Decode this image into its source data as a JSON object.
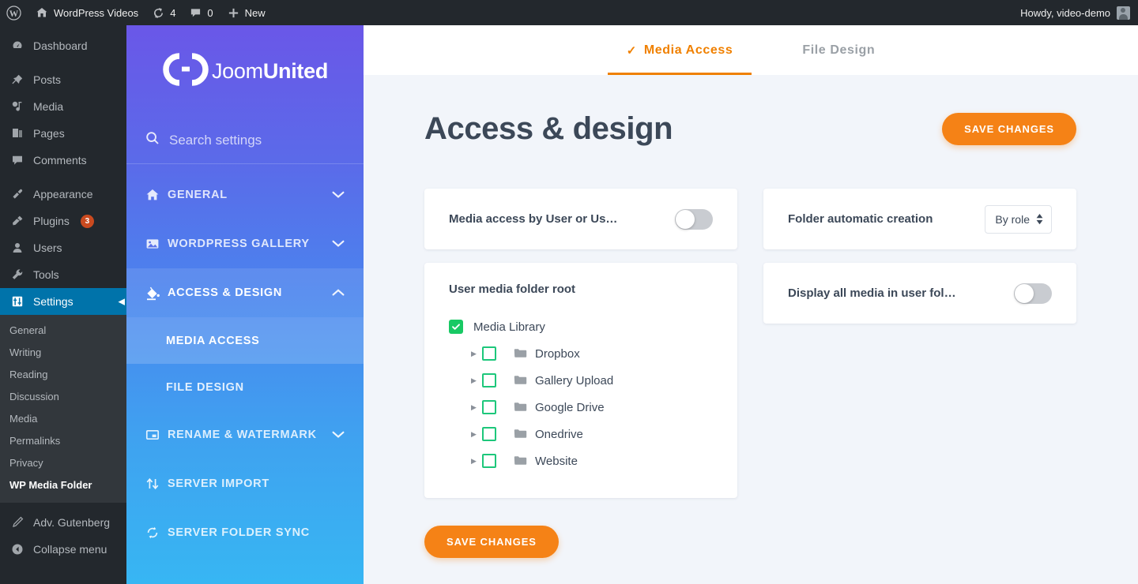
{
  "adminbar": {
    "site_name": "WordPress Videos",
    "updates_count": "4",
    "comments_count": "0",
    "new_label": "New",
    "howdy": "Howdy, video-demo"
  },
  "wpmenu": {
    "items": [
      {
        "label": "Dashboard",
        "icon": "dashboard-icon"
      },
      {
        "label": "Posts",
        "icon": "pin-icon"
      },
      {
        "label": "Media",
        "icon": "media-icon"
      },
      {
        "label": "Pages",
        "icon": "pages-icon"
      },
      {
        "label": "Comments",
        "icon": "comment-icon"
      },
      {
        "label": "Appearance",
        "icon": "brush-icon"
      },
      {
        "label": "Plugins",
        "icon": "plug-icon",
        "badge": "3"
      },
      {
        "label": "Users",
        "icon": "user-icon"
      },
      {
        "label": "Tools",
        "icon": "wrench-icon"
      },
      {
        "label": "Settings",
        "icon": "settings-icon",
        "active": true
      }
    ],
    "submenu": [
      {
        "label": "General"
      },
      {
        "label": "Writing"
      },
      {
        "label": "Reading"
      },
      {
        "label": "Discussion"
      },
      {
        "label": "Media"
      },
      {
        "label": "Permalinks"
      },
      {
        "label": "Privacy"
      },
      {
        "label": "WP Media Folder",
        "current": true
      }
    ],
    "footer": [
      {
        "label": "Adv. Gutenberg",
        "icon": "pencil-icon"
      },
      {
        "label": "Collapse menu",
        "icon": "collapse-icon"
      }
    ]
  },
  "sidebar": {
    "logo": {
      "part1": "Joom",
      "part2": "United"
    },
    "search": {
      "placeholder": "Search settings"
    },
    "nav": [
      {
        "label": "GENERAL",
        "icon": "home-icon",
        "chevron": "down"
      },
      {
        "label": "WORDPRESS GALLERY",
        "icon": "image-icon",
        "chevron": "down"
      },
      {
        "label": "ACCESS & DESIGN",
        "icon": "paint-bucket-icon",
        "chevron": "up",
        "open": true
      },
      {
        "label": "RENAME & WATERMARK",
        "icon": "watermark-icon",
        "chevron": "down"
      },
      {
        "label": "SERVER IMPORT",
        "icon": "import-arrows-icon",
        "chevron": ""
      },
      {
        "label": "SERVER FOLDER SYNC",
        "icon": "sync-icon",
        "chevron": ""
      }
    ],
    "subnav": [
      {
        "label": "MEDIA ACCESS",
        "selected": true
      },
      {
        "label": "FILE DESIGN",
        "selected": false
      }
    ]
  },
  "main": {
    "tabs": [
      {
        "label": "Media Access",
        "active": true,
        "check": "✓"
      },
      {
        "label": "File Design",
        "active": false,
        "check": ""
      }
    ],
    "page_title": "Access & design",
    "save_top_label": "SAVE CHANGES",
    "save_bottom_label": "SAVE CHANGES",
    "settings": {
      "media_access_label": "Media access by User or Us…",
      "media_access_toggle": "off",
      "folder_auto_label": "Folder automatic creation",
      "folder_auto_value": "By role",
      "display_all_label": "Display all media in user fol…",
      "display_all_toggle": "off"
    },
    "tree": {
      "title": "User media folder root",
      "root": {
        "label": "Media Library",
        "checked": true
      },
      "children": [
        {
          "label": "Dropbox",
          "checked": false
        },
        {
          "label": "Gallery Upload",
          "checked": false
        },
        {
          "label": "Google Drive",
          "checked": false
        },
        {
          "label": "Onedrive",
          "checked": false
        },
        {
          "label": "Website",
          "checked": false
        }
      ]
    }
  },
  "colors": {
    "accent_orange": "#f58216",
    "wp_blue": "#0073aa",
    "green_check": "#18c964",
    "sidebar_top": "#6a57e8",
    "sidebar_bottom": "#37b6f3",
    "bg": "#f2f5fa"
  }
}
